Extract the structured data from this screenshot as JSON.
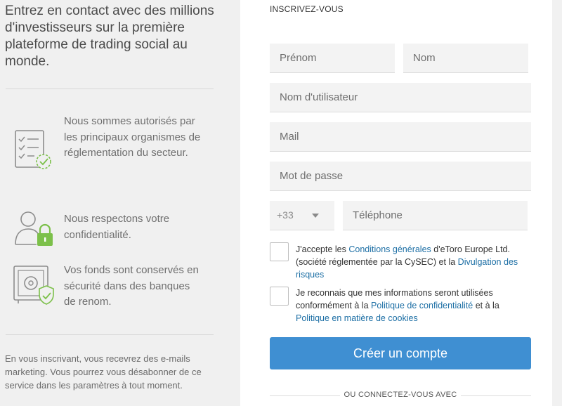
{
  "left": {
    "hero": "Entrez en contact avec des millions d'investisseurs sur la première plateforme de trading social au monde.",
    "features": [
      {
        "icon": "checklist-icon",
        "text": "Nous sommes autorisés par les principaux organismes de réglementation du secteur."
      },
      {
        "icon": "user-lock-icon",
        "text": "Nous respectons votre confidentialité."
      },
      {
        "icon": "safe-check-icon",
        "text": "Vos fonds sont conservés en sécurité dans des banques de renom."
      }
    ],
    "footnote": "En vous inscrivant, vous recevrez des e-mails marketing. Vous pourrez vous désabonner de ce service dans les paramètres à tout moment."
  },
  "form": {
    "title": "INSCRIVEZ-VOUS",
    "firstname_placeholder": "Prénom",
    "lastname_placeholder": "Nom",
    "username_placeholder": "Nom d'utilisateur",
    "email_placeholder": "Mail",
    "password_placeholder": "Mot de passe",
    "phone_prefix": "+33",
    "phone_placeholder": "Téléphone",
    "terms": {
      "t1": "J'accepte les ",
      "link1": "Conditions générales",
      "t2": " d'eToro Europe Ltd. (société réglementée par la CySEC) et la ",
      "link2": "Divulgation des risques"
    },
    "privacy": {
      "t1": "Je reconnais que mes informations seront utilisées conformément à la ",
      "link1": "Politique de confidentialité",
      "t2": " et à la ",
      "link2": "Politique en matière de cookies"
    },
    "submit_label": "Créer un compte",
    "or_connect": "OU CONNECTEZ-VOUS AVEC"
  },
  "colors": {
    "accent": "#3f8fd2",
    "link": "#1d6fa5",
    "check_green": "#7cc04a"
  }
}
